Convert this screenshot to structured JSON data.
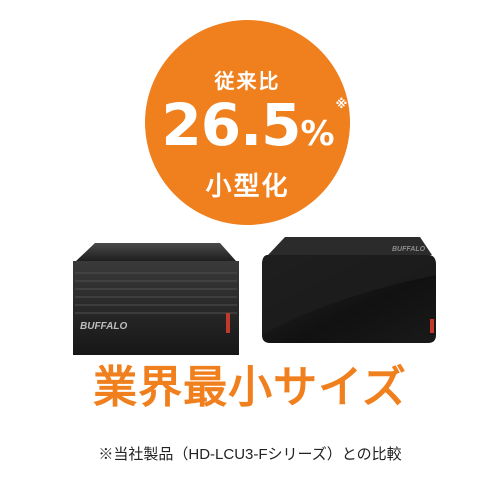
{
  "badge": {
    "top_text": "従来比",
    "value": "26.5",
    "percent": "%",
    "note_mark": "※",
    "bottom_text": "小型化",
    "color": "#f07f1e"
  },
  "products": {
    "left_brand": "BUFFALO"
  },
  "headline": "業界最小サイズ",
  "footnote": "※当社製品（HD-LCU3-Fシリーズ）との比較"
}
